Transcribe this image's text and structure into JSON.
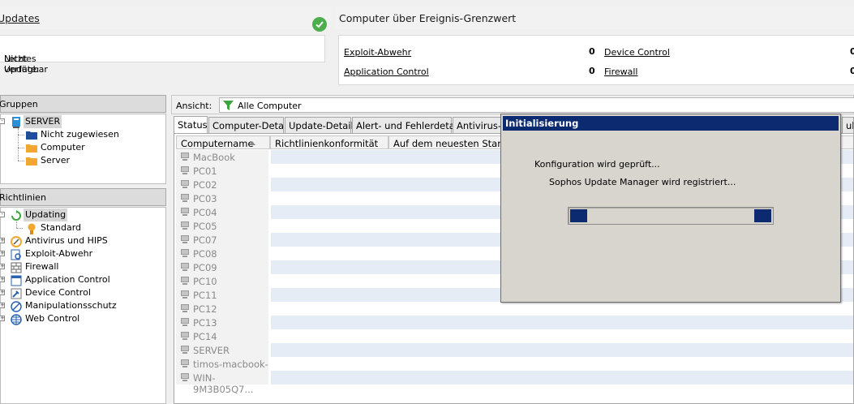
{
  "updates": {
    "title": "Updates",
    "last_update_label": "Letztes Update:",
    "last_update_value": "Nicht verfügbar"
  },
  "events": {
    "title": "Computer über Ereignis-Grenzwert",
    "items": [
      {
        "label": "Exploit-Abwehr",
        "value": "0"
      },
      {
        "label": "Device Control",
        "value": "0"
      },
      {
        "label": "Application Control",
        "value": "0"
      },
      {
        "label": "Firewall",
        "value": "0"
      }
    ]
  },
  "groups": {
    "title": "Gruppen",
    "nodes": [
      {
        "label": "SERVER"
      },
      {
        "label": "Nicht zugewiesen"
      },
      {
        "label": "Computer"
      },
      {
        "label": "Server"
      }
    ]
  },
  "policies": {
    "title": "Richtlinien",
    "nodes": [
      {
        "label": "Updating"
      },
      {
        "label": "Standard"
      },
      {
        "label": "Antivirus und HIPS"
      },
      {
        "label": "Exploit-Abwehr"
      },
      {
        "label": "Firewall"
      },
      {
        "label": "Application Control"
      },
      {
        "label": "Device Control"
      },
      {
        "label": "Manipulationsschutz"
      },
      {
        "label": "Web Control"
      }
    ]
  },
  "view": {
    "label": "Ansicht:",
    "value": "Alle Computer"
  },
  "tabs": [
    "Status",
    "Computer-Details",
    "Update-Details",
    "Alert- und Fehlerdetails",
    "Antivirus-D",
    "ulati"
  ],
  "grid": {
    "columns": [
      "Computername",
      "Richtlinienkonformität",
      "Auf dem neuesten Stand"
    ],
    "computers": [
      "MacBook",
      "PC01",
      "PC02",
      "PC03",
      "PC04",
      "PC05",
      "PC07",
      "PC08",
      "PC09",
      "PC10",
      "PC11",
      "PC12",
      "PC13",
      "PC14",
      "SERVER",
      "timos-macbook-p",
      "WIN-9M3B05Q7..."
    ]
  },
  "modal": {
    "title": "Initialisierung",
    "line1": "Konfiguration wird geprüft...",
    "line2": "Sophos Update Manager wird registriert...",
    "progress": 0.1
  },
  "colors": {
    "title_bar": "#0b2a6f",
    "check_green": "#4cae4c",
    "row_stripe": "#e6ecf6",
    "folder": "#f0a830",
    "folder_blue": "#1f4e9a"
  }
}
